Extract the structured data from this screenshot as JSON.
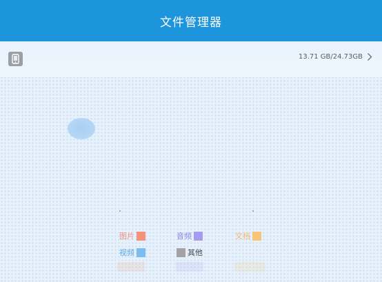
{
  "header": {
    "title": "文件管理器"
  },
  "storage": {
    "usage": "13.71 GB/24.73GB",
    "icon": "phone-icon",
    "chevron_icon": "chevron-right-icon"
  },
  "legend": {
    "items": [
      {
        "label": "图片",
        "color": "#f5917a"
      },
      {
        "label": "音频",
        "color": "#a59bf0"
      },
      {
        "label": "文档",
        "color": "#f6c57a"
      },
      {
        "label": "视频",
        "color": "#7bbdf0"
      },
      {
        "label": "其他",
        "color": "#a3a3a3"
      }
    ]
  },
  "colors": {
    "header_bg": "#1c95dd",
    "page_bg": "#e6f1fb"
  }
}
